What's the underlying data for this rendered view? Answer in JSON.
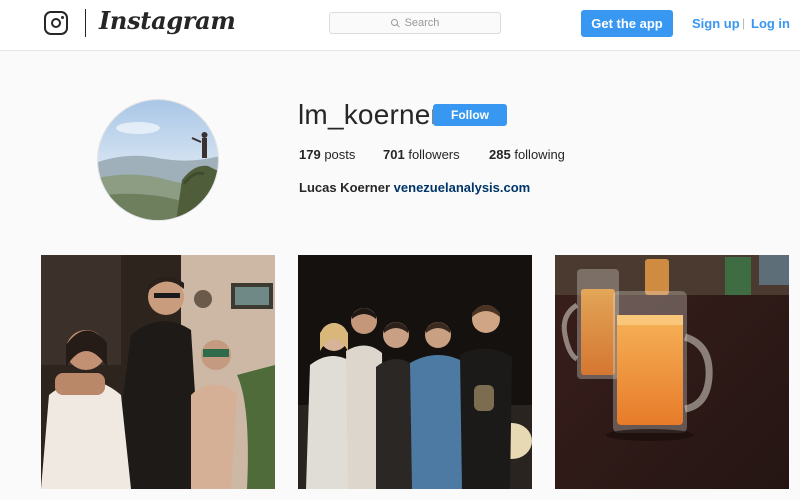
{
  "header": {
    "brand": "Instagram",
    "logo_icon": "instagram-camera-icon",
    "search": {
      "placeholder": "Search",
      "icon": "search-icon"
    },
    "get_app_label": "Get the app",
    "signup_label": "Sign up",
    "separator": "|",
    "login_label": "Log in"
  },
  "profile": {
    "username": "lm_koerner",
    "follow_label": "Follow",
    "stats": {
      "posts": {
        "count": "179",
        "label": "posts"
      },
      "followers": {
        "count": "701",
        "label": "followers"
      },
      "following": {
        "count": "285",
        "label": "following"
      }
    },
    "full_name": "Lucas Koerner",
    "website": "venezuelanalysis.com"
  },
  "colors": {
    "accent": "#3897f0",
    "text": "#262626",
    "link": "#003569",
    "background": "#fafafa"
  }
}
